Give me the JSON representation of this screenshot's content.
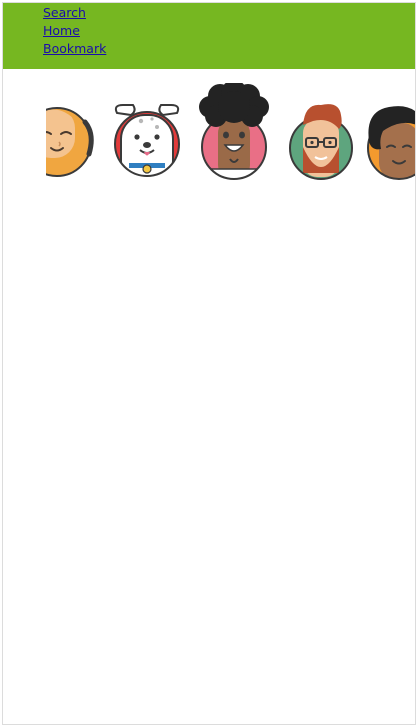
{
  "colors": {
    "accent": "#76b721",
    "link": "#1a0dab"
  },
  "nav": {
    "items": [
      {
        "label": "Search"
      },
      {
        "label": "Home"
      },
      {
        "label": "Bookmark"
      }
    ]
  },
  "avatars": [
    {
      "icon": "woman-headset-avatar-icon"
    },
    {
      "icon": "dog-avatar-icon"
    },
    {
      "icon": "afro-man-avatar-icon"
    },
    {
      "icon": "bearded-man-glasses-avatar-icon"
    },
    {
      "icon": "woman-dark-hair-avatar-icon"
    }
  ]
}
